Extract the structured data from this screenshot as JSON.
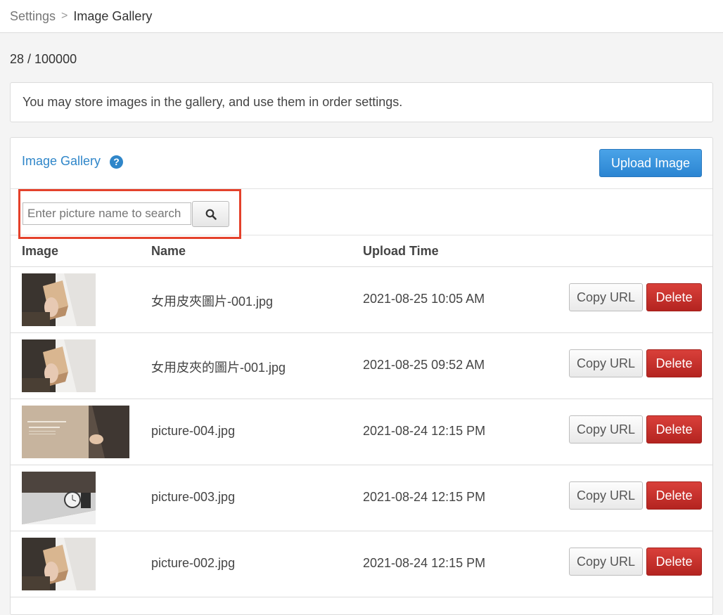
{
  "breadcrumb": {
    "parent": "Settings",
    "separator": ">",
    "current": "Image Gallery"
  },
  "usage": "28 / 100000",
  "notice": "You may store images in the gallery, and use them in order settings.",
  "panel": {
    "title": "Image Gallery",
    "help_icon": "?",
    "upload_label": "Upload Image"
  },
  "search": {
    "placeholder": "Enter picture name to search",
    "value": "",
    "icon": "search-icon"
  },
  "table": {
    "headers": [
      "Image",
      "Name",
      "Upload Time"
    ],
    "rows": [
      {
        "name": "女用皮夾圖片-001.jpg",
        "time": "2021-08-25 10:05 AM",
        "copy": "Copy URL",
        "delete": "Delete"
      },
      {
        "name": "女用皮夾的圖片-001.jpg",
        "time": "2021-08-25 09:52 AM",
        "copy": "Copy URL",
        "delete": "Delete"
      },
      {
        "name": "picture-004.jpg",
        "time": "2021-08-24 12:15 PM",
        "copy": "Copy URL",
        "delete": "Delete"
      },
      {
        "name": "picture-003.jpg",
        "time": "2021-08-24 12:15 PM",
        "copy": "Copy URL",
        "delete": "Delete"
      },
      {
        "name": "picture-002.jpg",
        "time": "2021-08-24 12:15 PM",
        "copy": "Copy URL",
        "delete": "Delete"
      }
    ]
  },
  "colors": {
    "link": "#2f86c9",
    "primary_button": "#2b85d2",
    "danger_button": "#b42420",
    "highlight_border": "#e4412b"
  }
}
